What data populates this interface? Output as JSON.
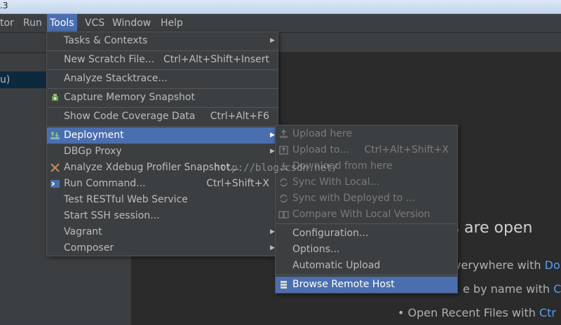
{
  "titlebar": {
    "text": ".3"
  },
  "menubar": {
    "items": [
      {
        "label": "tor"
      },
      {
        "label": "Run"
      },
      {
        "label": "Tools"
      },
      {
        "label": "VCS"
      },
      {
        "label": "Window"
      },
      {
        "label": "Help"
      }
    ]
  },
  "left_panel": {
    "selected_text": "u)"
  },
  "tools_menu": {
    "items": [
      {
        "label": "Tasks & Contexts",
        "shortcut": ""
      },
      {
        "label": "New Scratch File...",
        "shortcut": "Ctrl+Alt+Shift+Insert"
      },
      {
        "label": "Analyze Stacktrace...",
        "shortcut": ""
      },
      {
        "label": "Capture Memory Snapshot",
        "shortcut": ""
      },
      {
        "label": "Show Code Coverage Data",
        "shortcut": "Ctrl+Alt+F6"
      },
      {
        "label": "Deployment",
        "shortcut": ""
      },
      {
        "label": "DBGp Proxy",
        "shortcut": ""
      },
      {
        "label": "Analyze Xdebug Profiler Snapshot...",
        "shortcut": ""
      },
      {
        "label": "Run Command...",
        "shortcut": "Ctrl+Shift+X"
      },
      {
        "label": "Test RESTful Web Service",
        "shortcut": ""
      },
      {
        "label": "Start SSH session...",
        "shortcut": ""
      },
      {
        "label": "Vagrant",
        "shortcut": ""
      },
      {
        "label": "Composer",
        "shortcut": ""
      }
    ]
  },
  "deployment_menu": {
    "items": [
      {
        "label": "Upload here",
        "shortcut": ""
      },
      {
        "label": "Upload to...",
        "shortcut": "Ctrl+Alt+Shift+X"
      },
      {
        "label": "Download from here",
        "shortcut": ""
      },
      {
        "label": "Sync With Local...",
        "shortcut": ""
      },
      {
        "label": "Sync with Deployed to ...",
        "shortcut": ""
      },
      {
        "label": "Compare With Local Version",
        "shortcut": ""
      },
      {
        "label": "Configuration...",
        "shortcut": ""
      },
      {
        "label": "Options...",
        "shortcut": ""
      },
      {
        "label": "Automatic Upload",
        "shortcut": ""
      },
      {
        "label": "Browse Remote Host",
        "shortcut": ""
      }
    ]
  },
  "welcome": {
    "title": "es are open",
    "hints": [
      {
        "text": "verywhere with ",
        "key": "Do"
      },
      {
        "text": "e by name with ",
        "key": "C"
      },
      {
        "text": "• Open Recent Files with ",
        "key": "Ctr"
      }
    ]
  },
  "watermark": "http://blog.csdn.net/",
  "colors": {
    "accent": "#4b6eaf",
    "menu_bg": "#3c3f41",
    "editor_bg": "#2b2b2b",
    "link": "#589df6"
  }
}
